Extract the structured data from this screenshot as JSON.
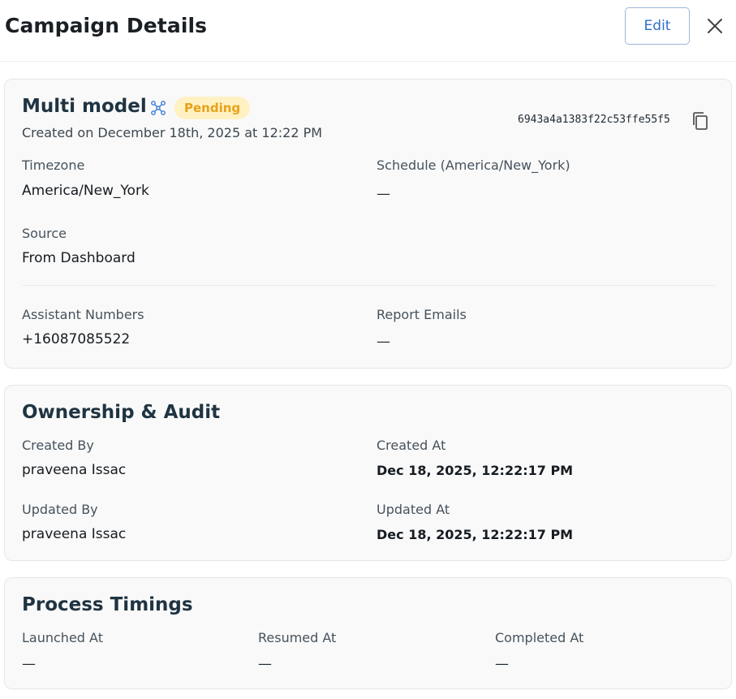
{
  "header": {
    "title": "Campaign Details",
    "edit_label": "Edit"
  },
  "campaign": {
    "name": "Multi model",
    "status": "Pending",
    "created_on": "Created on December 18th, 2025 at 12:22 PM",
    "id": "6943a4a1383f22c53ffe55f5",
    "fields": {
      "timezone_label": "Timezone",
      "timezone_value": "America/New_York",
      "schedule_label": "Schedule (America/New_York)",
      "schedule_value": "—",
      "source_label": "Source",
      "source_value": "From Dashboard",
      "assistant_numbers_label": "Assistant Numbers",
      "assistant_numbers_value": "+16087085522",
      "report_emails_label": "Report Emails",
      "report_emails_value": "—"
    }
  },
  "ownership": {
    "title": "Ownership & Audit",
    "created_by_label": "Created By",
    "created_by_value": "praveena Issac",
    "created_at_label": "Created At",
    "created_at_value": "Dec 18, 2025, 12:22:17 PM",
    "updated_by_label": "Updated By",
    "updated_by_value": "praveena Issac",
    "updated_at_label": "Updated At",
    "updated_at_value": "Dec 18, 2025, 12:22:17 PM"
  },
  "timings": {
    "title": "Process Timings",
    "launched_at_label": "Launched At",
    "launched_at_value": "—",
    "resumed_at_label": "Resumed At",
    "resumed_at_value": "—",
    "completed_at_label": "Completed At",
    "completed_at_value": "—"
  },
  "icons": {
    "close": "close-icon",
    "model": "model-network-icon",
    "copy": "copy-icon"
  },
  "colors": {
    "accent": "#2f6fc9",
    "pending_bg": "#fff1c2",
    "pending_text": "#e6a21a",
    "title_text": "#1f3442"
  }
}
